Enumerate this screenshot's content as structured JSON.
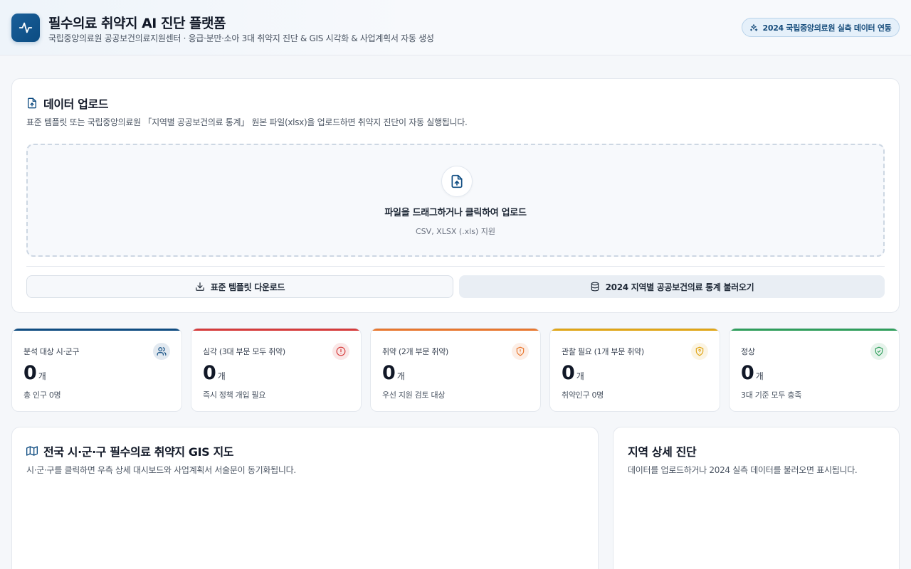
{
  "header": {
    "title": "필수의료 취약지 AI 진단 플랫폼",
    "subtitle": "국립중앙의료원 공공보건의료지원센터 · 응급·분만·소아 3대 취약지 진단 & GIS 시각화 & 사업계획서 자동 생성",
    "badge": "2024 국립중앙의료원 실측 데이터 연동",
    "logo_icon": "pulse-icon",
    "badge_icon": "sparkles-icon"
  },
  "upload": {
    "title": "데이터 업로드",
    "description": "표준 템플릿 또는 국립중앙의료원 「지역별 공공보건의료 통계」 원본 파일(xlsx)을 업로드하면 취약지 진단이 자동 실행됩니다.",
    "dropzone_title": "파일을 드래그하거나 클릭하여 업로드",
    "dropzone_sub": "CSV, XLSX (.xls) 지원",
    "template_button": "표준 템플릿 다운로드",
    "load_button": "2024 지역별 공공보건의료 통계 불러오기"
  },
  "stats": [
    {
      "label": "분석 대상 시·군구",
      "value": "0",
      "unit": "개",
      "note": "총 인구 0명",
      "color": "#0f4c81",
      "icon": "users-icon"
    },
    {
      "label": "심각 (3대 부문 모두 취약)",
      "value": "0",
      "unit": "개",
      "note": "즉시 정책 개입 필요",
      "color": "#d63b3b",
      "icon": "alert-circle-icon"
    },
    {
      "label": "취약 (2개 부문 취약)",
      "value": "0",
      "unit": "개",
      "note": "우선 지원 검토 대상",
      "color": "#e8772e",
      "icon": "shield-alert-icon"
    },
    {
      "label": "관찰 필요 (1개 부문 취약)",
      "value": "0",
      "unit": "개",
      "note": "취약인구 0명",
      "color": "#e0a516",
      "icon": "shield-question-icon"
    },
    {
      "label": "정상",
      "value": "0",
      "unit": "개",
      "note": "3대 기준 모두 충족",
      "color": "#2f9e5b",
      "icon": "shield-check-icon"
    }
  ],
  "map": {
    "title": "전국 시·군·구 필수의료 취약지 GIS 지도",
    "description": "시·군·구를 클릭하면 우측 상세 대시보드와 사업계획서 서술문이 동기화됩니다."
  },
  "detail": {
    "title": "지역 상세 진단",
    "description": "데이터를 업로드하거나 2024 실측 데이터를 불러오면 표시됩니다."
  }
}
